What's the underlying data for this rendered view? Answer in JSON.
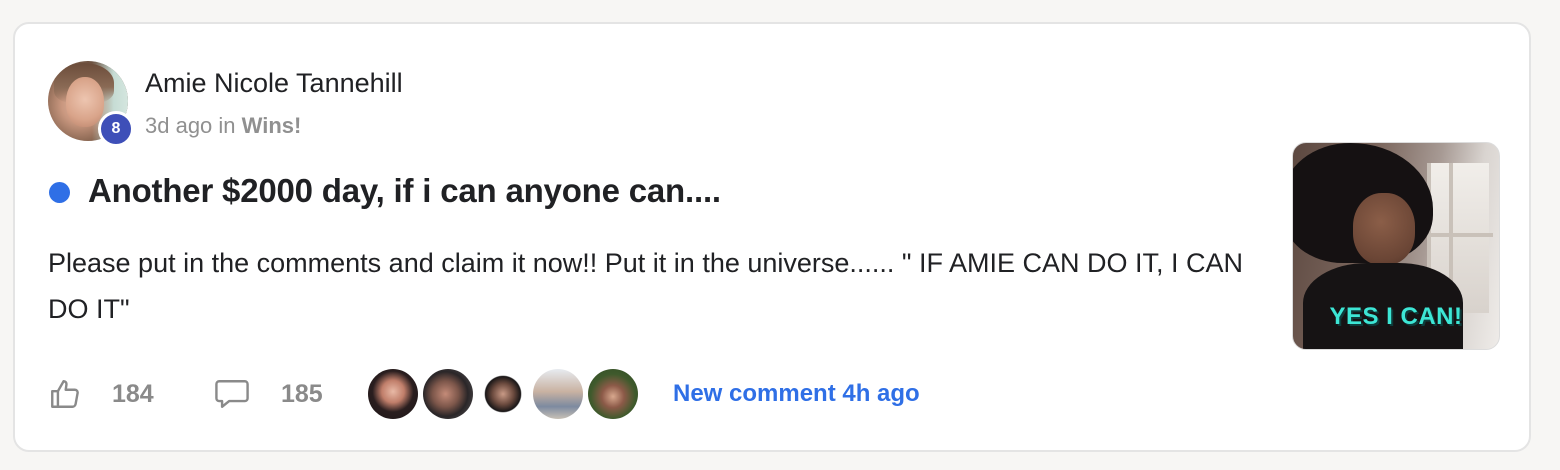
{
  "post": {
    "author": "Amie Nicole Tannehill",
    "level": "8",
    "time_ago": "3d ago in",
    "category": "Wins!",
    "title": "Another $2000 day, if i can anyone can....",
    "body": "Please put in the comments and claim it now!! Put it in the universe...... \" IF AMIE CAN DO IT, I CAN DO IT\"",
    "attachment_text": "YES I CAN!",
    "likes": "184",
    "comments": "185",
    "new_comment": "New comment 4h ago"
  },
  "colors": {
    "accent": "#2f6fe6",
    "level_badge": "#3e4fb8",
    "muted": "#909090"
  },
  "icons": {
    "like": "thumbs-up-icon",
    "comment": "speech-bubble-icon",
    "unread": "unread-dot"
  }
}
